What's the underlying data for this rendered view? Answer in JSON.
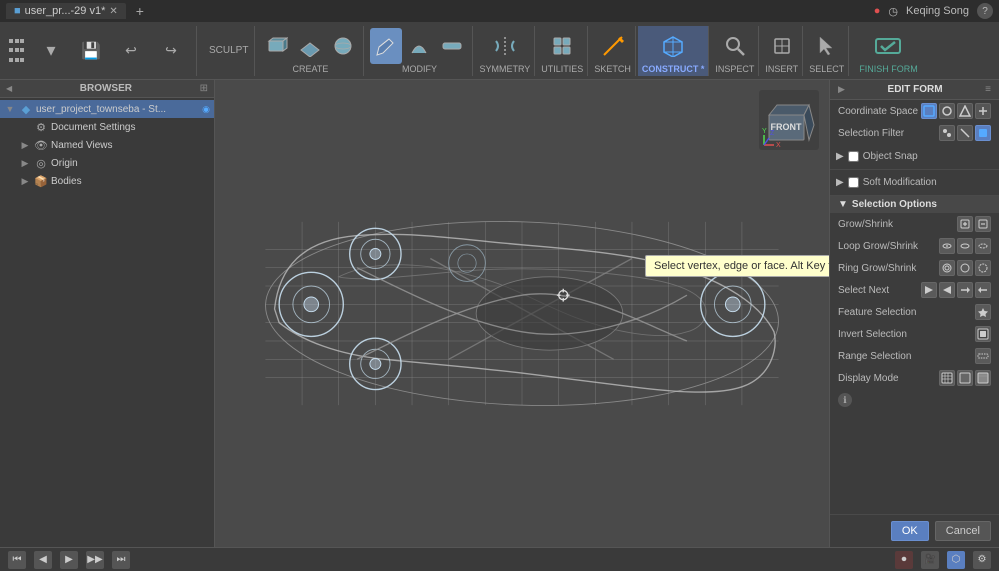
{
  "titleBar": {
    "tab": "user_pr...-29 v1*",
    "newTabIcon": "+",
    "userLabel": "Keqing Song",
    "helpIcon": "?"
  },
  "toolbar": {
    "sculpt_label": "SCULPT",
    "create_label": "CREATE",
    "modify_label": "MODIFY",
    "symmetry_label": "SYMMETRY",
    "utilities_label": "UTILITIES",
    "sketch_label": "SKETCH",
    "construct_label": "CONSTRUCT *",
    "inspect_label": "INSPECT",
    "insert_label": "INSERT",
    "select_label": "SELECT",
    "finish_label": "FINISH FORM"
  },
  "browser": {
    "header": "BROWSER",
    "items": [
      {
        "id": "root",
        "label": "user_project_townseba - St...",
        "indent": 0,
        "hasArrow": true,
        "type": "file"
      },
      {
        "id": "doc",
        "label": "Document Settings",
        "indent": 1,
        "hasArrow": false,
        "type": "doc"
      },
      {
        "id": "named",
        "label": "Named Views",
        "indent": 1,
        "hasArrow": false,
        "type": "eye"
      },
      {
        "id": "origin",
        "label": "Origin",
        "indent": 1,
        "hasArrow": true,
        "type": "folder"
      },
      {
        "id": "bodies",
        "label": "Bodies",
        "indent": 1,
        "hasArrow": true,
        "type": "folder"
      }
    ]
  },
  "viewport": {
    "tooltip": "Select vertex, edge or face. Alt Key to extrude",
    "cubeLabel": "FRONT"
  },
  "editPanel": {
    "title": "EDIT FORM",
    "coordinateSpace": "Coordinate Space",
    "selectionFilter": "Selection Filter",
    "objectSnap": "Object Snap",
    "softModification": "Soft Modification",
    "selectionOptions": "Selection Options",
    "rows": [
      {
        "label": "Grow/Shrink",
        "icons": 2
      },
      {
        "label": "Loop Grow/Shrink",
        "icons": 3
      },
      {
        "label": "Ring Grow/Shrink",
        "icons": 3
      },
      {
        "label": "Select Next",
        "icons": 4
      },
      {
        "label": "Feature Selection",
        "icons": 1
      },
      {
        "label": "Invert  Selection",
        "icons": 1
      },
      {
        "label": "Range  Selection",
        "icons": 1
      },
      {
        "label": "Display Mode",
        "icons": 3
      }
    ],
    "okButton": "OK",
    "cancelButton": "Cancel"
  },
  "bottomBar": {
    "navIcons": [
      "◀◀",
      "◀",
      "▶",
      "▶▶",
      "⏹"
    ],
    "viewIcons": [
      "grid",
      "camera",
      "settings"
    ]
  }
}
